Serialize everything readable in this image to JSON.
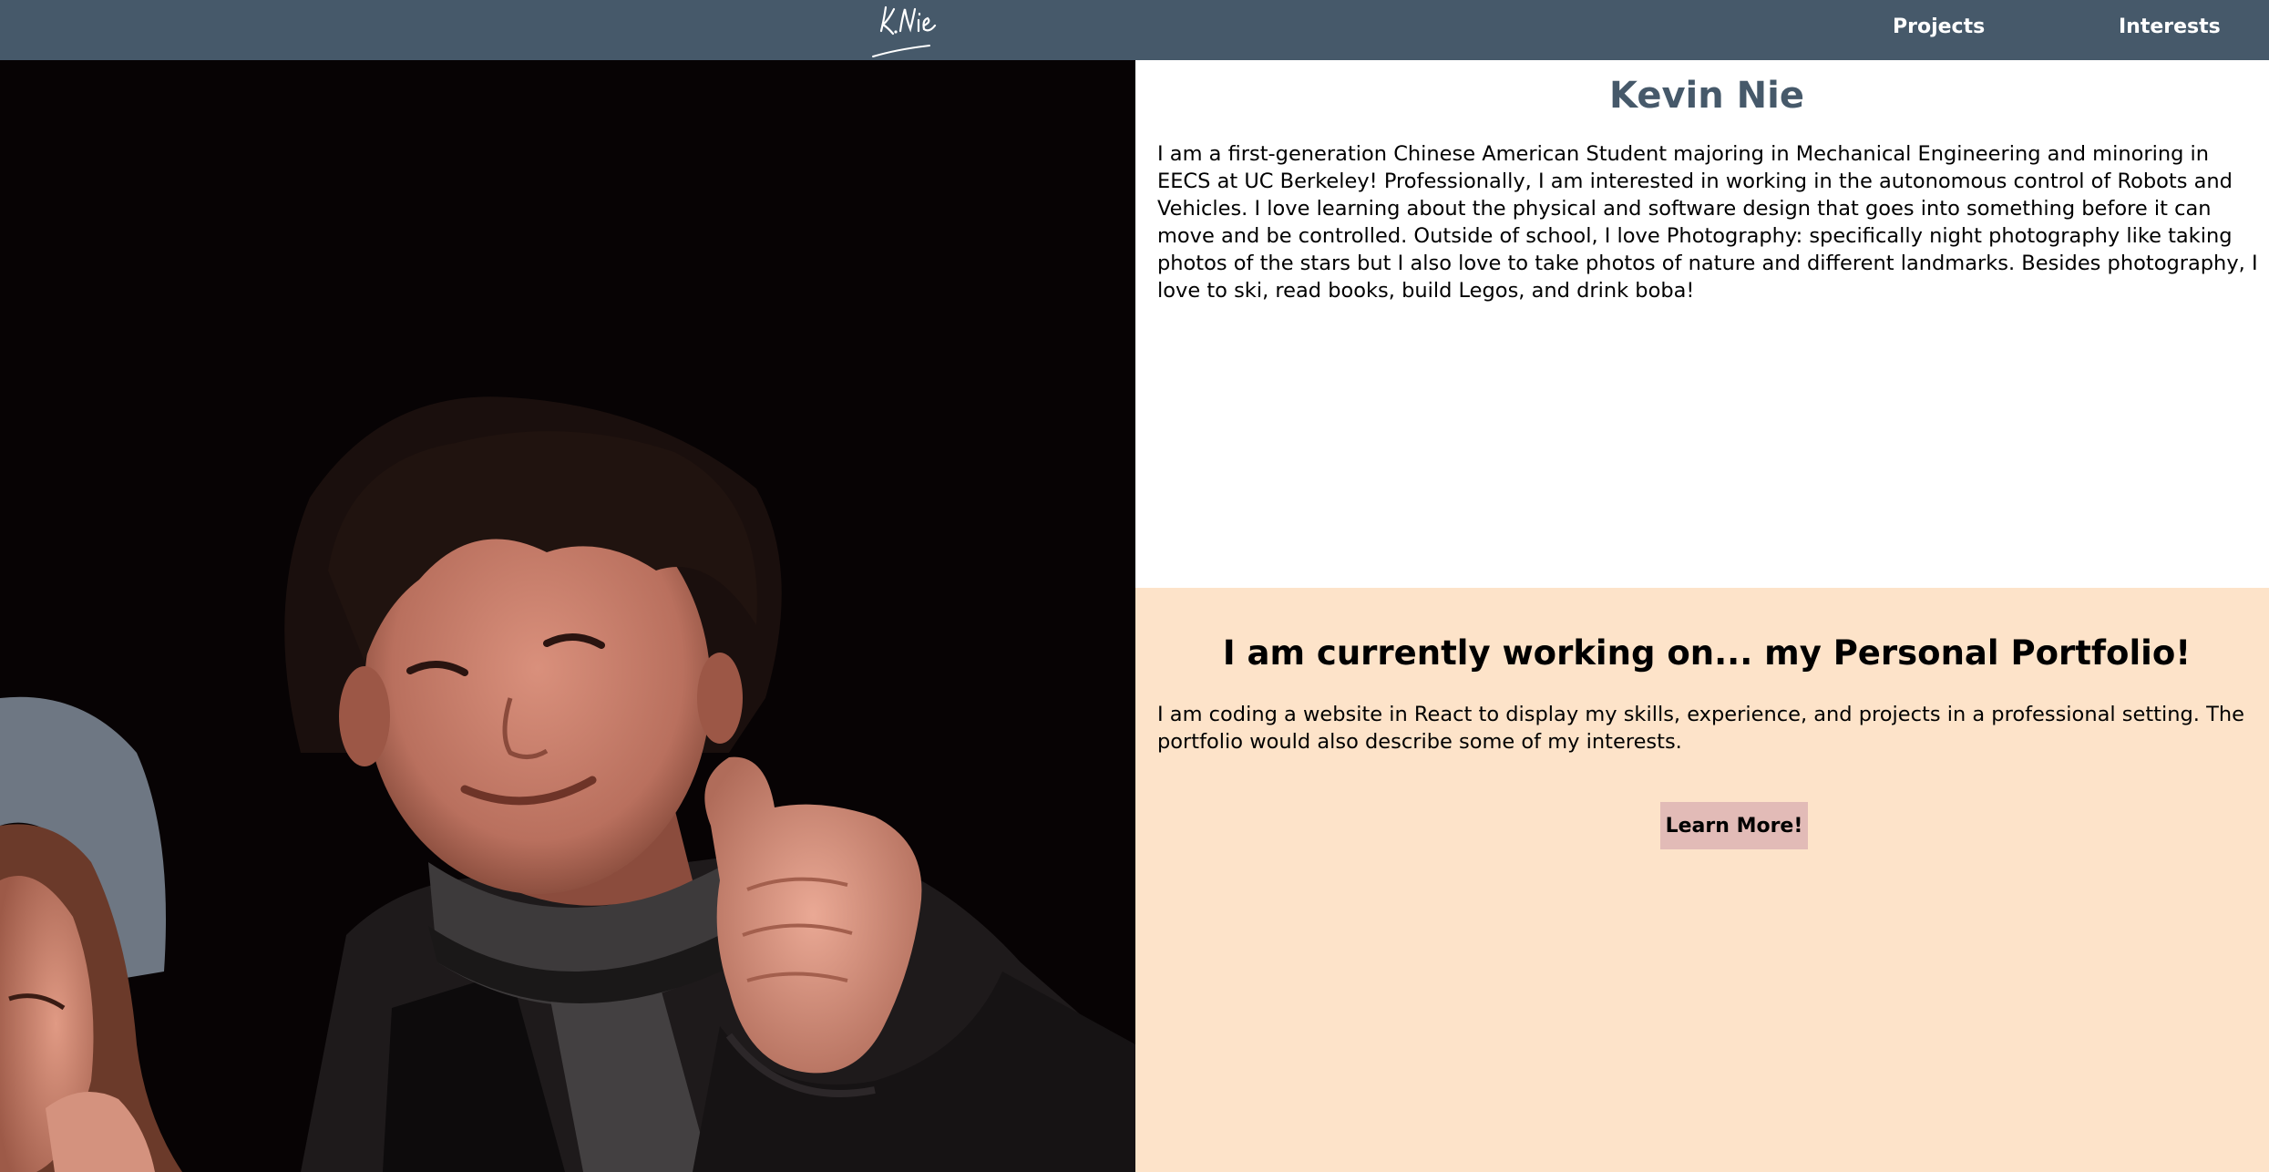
{
  "navbar": {
    "logo_text": "K.Nie",
    "links": [
      {
        "label": "Projects"
      },
      {
        "label": "Interests"
      }
    ]
  },
  "about": {
    "name": "Kevin Nie",
    "bio": "I am a first-generation Chinese American Student majoring in Mechanical Engineering and minoring in EECS at UC Berkeley! Professionally, I am interested in working in the autonomous control of Robots and Vehicles. I love learning about the physical and software design that goes into something before it can move and be controlled. Outside of school, I love Photography: specifically night photography like taking photos of the stars but I also love to take photos of nature and different landmarks. Besides photography, I love to ski, read books, build Legos, and drink boba!"
  },
  "current_project": {
    "heading": "I am currently working on... my Personal Portfolio!",
    "description": "I am coding a website in React to display my skills, experience, and projects in a professional setting. The portfolio would also describe some of my interests.",
    "button_label": "Learn More!"
  },
  "colors": {
    "navbar": "#46596a",
    "name_heading": "#46596a",
    "current_bg": "#fde3c9",
    "button_bg": "#e2bbb7"
  }
}
